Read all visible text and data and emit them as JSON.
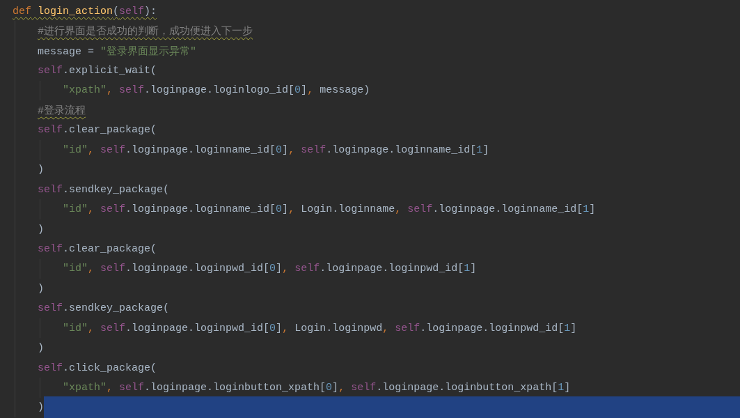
{
  "lines": [
    {
      "warning": true,
      "selected": false,
      "tokens": [
        {
          "kind": "keyword",
          "text": "def"
        },
        {
          "kind": "function",
          "text": " login_action"
        },
        {
          "kind": "plain",
          "text": "("
        },
        {
          "kind": "self",
          "text": "self"
        },
        {
          "kind": "plain",
          "text": "):"
        }
      ],
      "children": [
        {
          "warning": true,
          "selected": false,
          "tokens": [
            {
              "kind": "comment",
              "text": "#进行界面是否成功的判断，成功便进入下一步"
            }
          ]
        },
        {
          "warning": false,
          "selected": false,
          "tokens": [
            {
              "kind": "plain",
              "text": "message = "
            },
            {
              "kind": "string",
              "text": "\"登录界面显示异常\""
            }
          ]
        },
        {
          "warning": false,
          "selected": false,
          "tokens": [
            {
              "kind": "self",
              "text": "self"
            },
            {
              "kind": "plain",
              "text": ".explicit_wait("
            }
          ],
          "children": [
            {
              "warning": false,
              "selected": false,
              "tokens": [
                {
                  "kind": "string",
                  "text": "\"xpath\""
                },
                {
                  "kind": "punct",
                  "text": ", "
                },
                {
                  "kind": "self",
                  "text": "self"
                },
                {
                  "kind": "plain",
                  "text": ".loginpage.loginlogo_id["
                },
                {
                  "kind": "number",
                  "text": "0"
                },
                {
                  "kind": "plain",
                  "text": "]"
                },
                {
                  "kind": "punct",
                  "text": ", "
                },
                {
                  "kind": "plain",
                  "text": "message)"
                }
              ]
            }
          ]
        },
        {
          "warning": true,
          "selected": false,
          "tokens": [
            {
              "kind": "comment",
              "text": "#登录流程"
            }
          ]
        },
        {
          "warning": false,
          "selected": false,
          "tokens": [
            {
              "kind": "self",
              "text": "self"
            },
            {
              "kind": "plain",
              "text": ".clear_package("
            }
          ],
          "children": [
            {
              "warning": false,
              "selected": false,
              "tokens": [
                {
                  "kind": "string",
                  "text": "\"id\""
                },
                {
                  "kind": "punct",
                  "text": ", "
                },
                {
                  "kind": "self",
                  "text": "self"
                },
                {
                  "kind": "plain",
                  "text": ".loginpage.loginname_id["
                },
                {
                  "kind": "number",
                  "text": "0"
                },
                {
                  "kind": "plain",
                  "text": "]"
                },
                {
                  "kind": "punct",
                  "text": ", "
                },
                {
                  "kind": "self",
                  "text": "self"
                },
                {
                  "kind": "plain",
                  "text": ".loginpage.loginname_id["
                },
                {
                  "kind": "number",
                  "text": "1"
                },
                {
                  "kind": "plain",
                  "text": "]"
                }
              ]
            }
          ]
        },
        {
          "warning": false,
          "selected": false,
          "tokens": [
            {
              "kind": "plain",
              "text": ")"
            }
          ]
        },
        {
          "warning": false,
          "selected": false,
          "tokens": [
            {
              "kind": "self",
              "text": "self"
            },
            {
              "kind": "plain",
              "text": ".sendkey_package("
            }
          ],
          "children": [
            {
              "warning": false,
              "selected": false,
              "tokens": [
                {
                  "kind": "string",
                  "text": "\"id\""
                },
                {
                  "kind": "punct",
                  "text": ", "
                },
                {
                  "kind": "self",
                  "text": "self"
                },
                {
                  "kind": "plain",
                  "text": ".loginpage.loginname_id["
                },
                {
                  "kind": "number",
                  "text": "0"
                },
                {
                  "kind": "plain",
                  "text": "]"
                },
                {
                  "kind": "punct",
                  "text": ", "
                },
                {
                  "kind": "plain",
                  "text": "Login.loginname"
                },
                {
                  "kind": "punct",
                  "text": ", "
                },
                {
                  "kind": "self",
                  "text": "self"
                },
                {
                  "kind": "plain",
                  "text": ".loginpage.loginname_id["
                },
                {
                  "kind": "number",
                  "text": "1"
                },
                {
                  "kind": "plain",
                  "text": "]"
                }
              ]
            }
          ]
        },
        {
          "warning": false,
          "selected": false,
          "tokens": [
            {
              "kind": "plain",
              "text": ")"
            }
          ]
        },
        {
          "warning": false,
          "selected": false,
          "tokens": [
            {
              "kind": "self",
              "text": "self"
            },
            {
              "kind": "plain",
              "text": ".clear_package("
            }
          ],
          "children": [
            {
              "warning": false,
              "selected": false,
              "tokens": [
                {
                  "kind": "string",
                  "text": "\"id\""
                },
                {
                  "kind": "punct",
                  "text": ", "
                },
                {
                  "kind": "self",
                  "text": "self"
                },
                {
                  "kind": "plain",
                  "text": ".loginpage.loginpwd_id["
                },
                {
                  "kind": "number",
                  "text": "0"
                },
                {
                  "kind": "plain",
                  "text": "]"
                },
                {
                  "kind": "punct",
                  "text": ", "
                },
                {
                  "kind": "self",
                  "text": "self"
                },
                {
                  "kind": "plain",
                  "text": ".loginpage.loginpwd_id["
                },
                {
                  "kind": "number",
                  "text": "1"
                },
                {
                  "kind": "plain",
                  "text": "]"
                }
              ]
            }
          ]
        },
        {
          "warning": false,
          "selected": false,
          "tokens": [
            {
              "kind": "plain",
              "text": ")"
            }
          ]
        },
        {
          "warning": false,
          "selected": false,
          "tokens": [
            {
              "kind": "self",
              "text": "self"
            },
            {
              "kind": "plain",
              "text": ".sendkey_package("
            }
          ],
          "children": [
            {
              "warning": false,
              "selected": false,
              "tokens": [
                {
                  "kind": "string",
                  "text": "\"id\""
                },
                {
                  "kind": "punct",
                  "text": ", "
                },
                {
                  "kind": "self",
                  "text": "self"
                },
                {
                  "kind": "plain",
                  "text": ".loginpage.loginpwd_id["
                },
                {
                  "kind": "number",
                  "text": "0"
                },
                {
                  "kind": "plain",
                  "text": "]"
                },
                {
                  "kind": "punct",
                  "text": ", "
                },
                {
                  "kind": "plain",
                  "text": "Login.loginpwd"
                },
                {
                  "kind": "punct",
                  "text": ", "
                },
                {
                  "kind": "self",
                  "text": "self"
                },
                {
                  "kind": "plain",
                  "text": ".loginpage.loginpwd_id["
                },
                {
                  "kind": "number",
                  "text": "1"
                },
                {
                  "kind": "plain",
                  "text": "]"
                }
              ]
            }
          ]
        },
        {
          "warning": false,
          "selected": false,
          "tokens": [
            {
              "kind": "plain",
              "text": ")"
            }
          ]
        },
        {
          "warning": false,
          "selected": false,
          "tokens": [
            {
              "kind": "self",
              "text": "self"
            },
            {
              "kind": "plain",
              "text": ".click_package("
            }
          ],
          "children": [
            {
              "warning": false,
              "selected": false,
              "tokens": [
                {
                  "kind": "string",
                  "text": "\"xpath\""
                },
                {
                  "kind": "punct",
                  "text": ", "
                },
                {
                  "kind": "self",
                  "text": "self"
                },
                {
                  "kind": "plain",
                  "text": ".loginpage.loginbutton_xpath["
                },
                {
                  "kind": "number",
                  "text": "0"
                },
                {
                  "kind": "plain",
                  "text": "]"
                },
                {
                  "kind": "punct",
                  "text": ", "
                },
                {
                  "kind": "self",
                  "text": "self"
                },
                {
                  "kind": "plain",
                  "text": ".loginpage.loginbutton_xpath["
                },
                {
                  "kind": "number",
                  "text": "1"
                },
                {
                  "kind": "plain",
                  "text": "]"
                }
              ]
            }
          ]
        },
        {
          "warning": false,
          "selected": true,
          "tokens": [
            {
              "kind": "plain",
              "text": ")"
            }
          ]
        }
      ]
    }
  ]
}
